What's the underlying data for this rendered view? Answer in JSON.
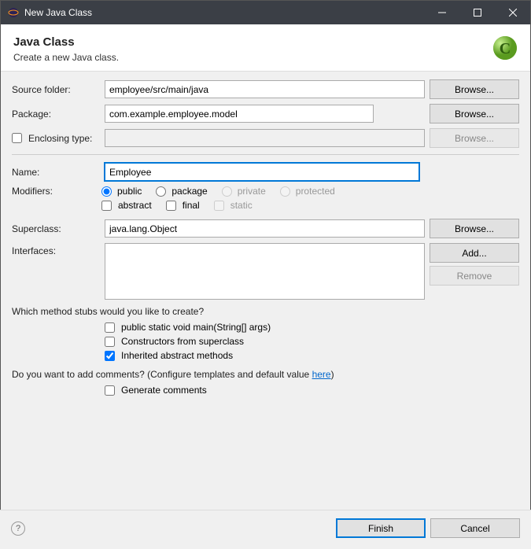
{
  "window": {
    "title": "New Java Class"
  },
  "header": {
    "title": "Java Class",
    "subtitle": "Create a new Java class."
  },
  "fields": {
    "source_folder_label": "Source folder:",
    "source_folder_value": "employee/src/main/java",
    "package_label": "Package:",
    "package_value": "com.example.employee.model",
    "enclosing_type_label": "Enclosing type:",
    "enclosing_type_value": "",
    "name_label": "Name:",
    "name_value": "Employee",
    "modifiers_label": "Modifiers:",
    "superclass_label": "Superclass:",
    "superclass_value": "java.lang.Object",
    "interfaces_label": "Interfaces:"
  },
  "modifiers": {
    "access": [
      "public",
      "package",
      "private",
      "protected"
    ],
    "access_selected": "public",
    "abstract": "abstract",
    "final": "final",
    "static": "static"
  },
  "buttons": {
    "browse": "Browse...",
    "add": "Add...",
    "remove": "Remove",
    "finish": "Finish",
    "cancel": "Cancel"
  },
  "stubs": {
    "question": "Which method stubs would you like to create?",
    "main": "public static void main(String[] args)",
    "constructors": "Constructors from superclass",
    "inherited": "Inherited abstract methods"
  },
  "comments": {
    "question_pre": "Do you want to add comments? (Configure templates and default value ",
    "link": "here",
    "question_post": ")",
    "generate": "Generate comments"
  }
}
